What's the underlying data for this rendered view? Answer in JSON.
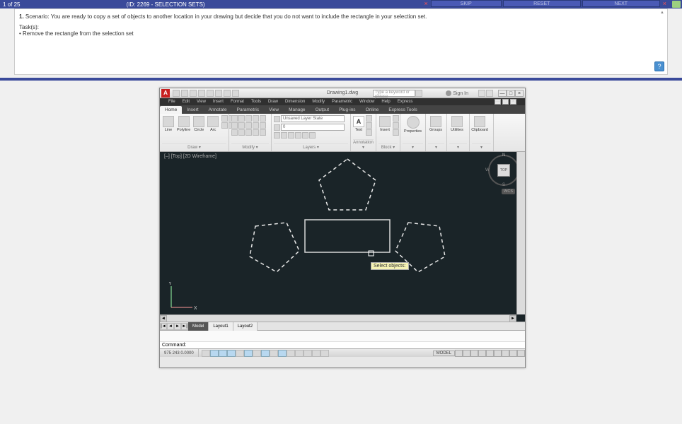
{
  "header": {
    "page_count": "1 of 25",
    "title": "(ID: 2269 - SELECTION SETS)",
    "skip_label": "SKIP",
    "reset_label": "RESET",
    "next_label": "NEXT"
  },
  "instructions": {
    "scenario_num": "1.",
    "scenario_label": "Scenario:",
    "scenario_text": "You are ready to copy a set of objects to another location in your drawing but decide that you do not want to include the rectangle in your selection set.",
    "tasks_label": "Task(s):",
    "task_1": "• Remove the rectangle from the selection set"
  },
  "app": {
    "filename": "Drawing1.dwg",
    "search_placeholder": "Type a keyword or phrase",
    "signin": "Sign In",
    "help_symbol": "?",
    "window": {
      "min": "—",
      "max": "□",
      "close": "×"
    }
  },
  "menubar": [
    "File",
    "Edit",
    "View",
    "Insert",
    "Format",
    "Tools",
    "Draw",
    "Dimension",
    "Modify",
    "Parametric",
    "Window",
    "Help",
    "Express"
  ],
  "ribbon_tabs": [
    "Home",
    "Insert",
    "Annotate",
    "Parametric",
    "View",
    "Manage",
    "Output",
    "Plug-ins",
    "Online",
    "Express Tools"
  ],
  "ribbon": {
    "draw": {
      "title": "Draw ▾",
      "line": "Line",
      "polyline": "Polyline",
      "circle": "Circle",
      "arc": "Arc"
    },
    "modify": {
      "title": "Modify ▾"
    },
    "layers": {
      "title": "Layers ▾",
      "state_label": "Unsaved Layer State"
    },
    "annotation": {
      "title": "Annotation ▾",
      "text": "Text"
    },
    "block": {
      "title": "Block ▾",
      "insert": "Insert"
    },
    "properties": {
      "title": "▾",
      "label": "Properties"
    },
    "groups": {
      "title": "▾",
      "label": "Groups"
    },
    "utilities": {
      "title": "▾",
      "label": "Utilities"
    },
    "clipboard": {
      "title": "▾",
      "label": "Clipboard"
    }
  },
  "viewport": {
    "label": "[–] [Top] [2D Wireframe]",
    "tooltip": "Select objects:",
    "cube_face": "TOP",
    "wcs": "WCS",
    "ucs_x": "X",
    "ucs_y": "Y"
  },
  "layout": {
    "model": "Model",
    "layout1": "Layout1",
    "layout2": "Layout2"
  },
  "command": {
    "prompt": "Command:"
  },
  "status": {
    "coords": "975      243  0.0000",
    "model": "MODEL"
  }
}
